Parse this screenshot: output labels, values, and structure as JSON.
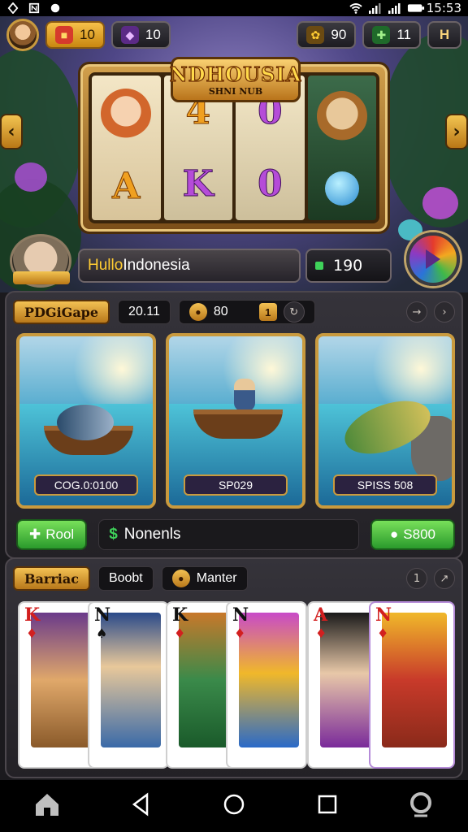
{
  "status_bar": {
    "time": "15:53"
  },
  "top_bar": {
    "gold_value": "10",
    "gem_value": "10",
    "star_value": "90",
    "clover_value": "11",
    "menu_label": "H"
  },
  "slot": {
    "title": "NDHOUSIA",
    "subtitle": "SHNI NUB",
    "symbols": [
      "A",
      "4",
      "K",
      "0",
      "0"
    ]
  },
  "player": {
    "tag": "",
    "name_highlight": "Hullo",
    "name_rest": " Indonesia",
    "credit": "190"
  },
  "fishing_panel": {
    "header_tag": "PDGiGape",
    "value": "20.11",
    "coin_value": "80",
    "badge": "1",
    "cards": [
      {
        "caption": "COG.0:0100"
      },
      {
        "caption": "SP029"
      },
      {
        "caption": "SPISS 508"
      }
    ],
    "btn_left": "Rool",
    "info_text": "Nonenls",
    "btn_right": "S800"
  },
  "card_panel": {
    "header_tag": "Barriac",
    "chip1": "Boobt",
    "chip2": "Manter",
    "page": "1",
    "cards": [
      {
        "rank": "K",
        "suit": "♦",
        "color": "red"
      },
      {
        "rank": "N",
        "suit": "♠",
        "color": "blk"
      },
      {
        "rank": "K",
        "suit": "♦",
        "color": "blk"
      },
      {
        "rank": "N",
        "suit": "♦",
        "color": "blk"
      },
      {
        "rank": "A",
        "suit": "♦",
        "color": "red"
      },
      {
        "rank": "N",
        "suit": "♦",
        "color": "red"
      }
    ]
  },
  "colors": {
    "accent_gold": "#f3c153",
    "accent_green": "#3fd25a",
    "frame_brown": "#5a3308"
  }
}
